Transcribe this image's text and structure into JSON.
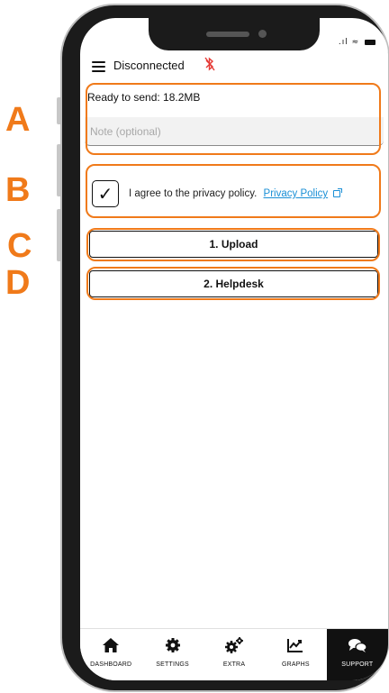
{
  "status_bar": {
    "signal": "…ll",
    "wifi": "≈"
  },
  "header": {
    "title": "Disconnected",
    "bluetooth_icon": "bluetooth-disabled-icon"
  },
  "section_a": {
    "ready_text": "Ready to send: 18.2MB",
    "note_placeholder": "Note (optional)",
    "note_value": ""
  },
  "section_b": {
    "checked": true,
    "check_mark": "✓",
    "agree_text": "I agree to the privacy policy.",
    "policy_link": "Privacy Policy"
  },
  "buttons": {
    "upload_label": "1. Upload",
    "helpdesk_label": "2. Helpdesk"
  },
  "annotations": {
    "a": "A",
    "b": "B",
    "c": "C",
    "d": "D",
    "color": "#f07a1a"
  },
  "bottom_nav": {
    "items": [
      {
        "label": "DASHBOARD",
        "icon": "home-icon",
        "active": false
      },
      {
        "label": "SETTINGS",
        "icon": "gear-icon",
        "active": false
      },
      {
        "label": "EXTRA",
        "icon": "gears-icon",
        "active": false
      },
      {
        "label": "GRAPHS",
        "icon": "chart-icon",
        "active": false
      },
      {
        "label": "SUPPORT",
        "icon": "chat-icon",
        "active": true
      }
    ]
  },
  "colors": {
    "link": "#1a8fd6",
    "bluetooth_disabled": "#e53935",
    "active_nav": "#111111"
  }
}
